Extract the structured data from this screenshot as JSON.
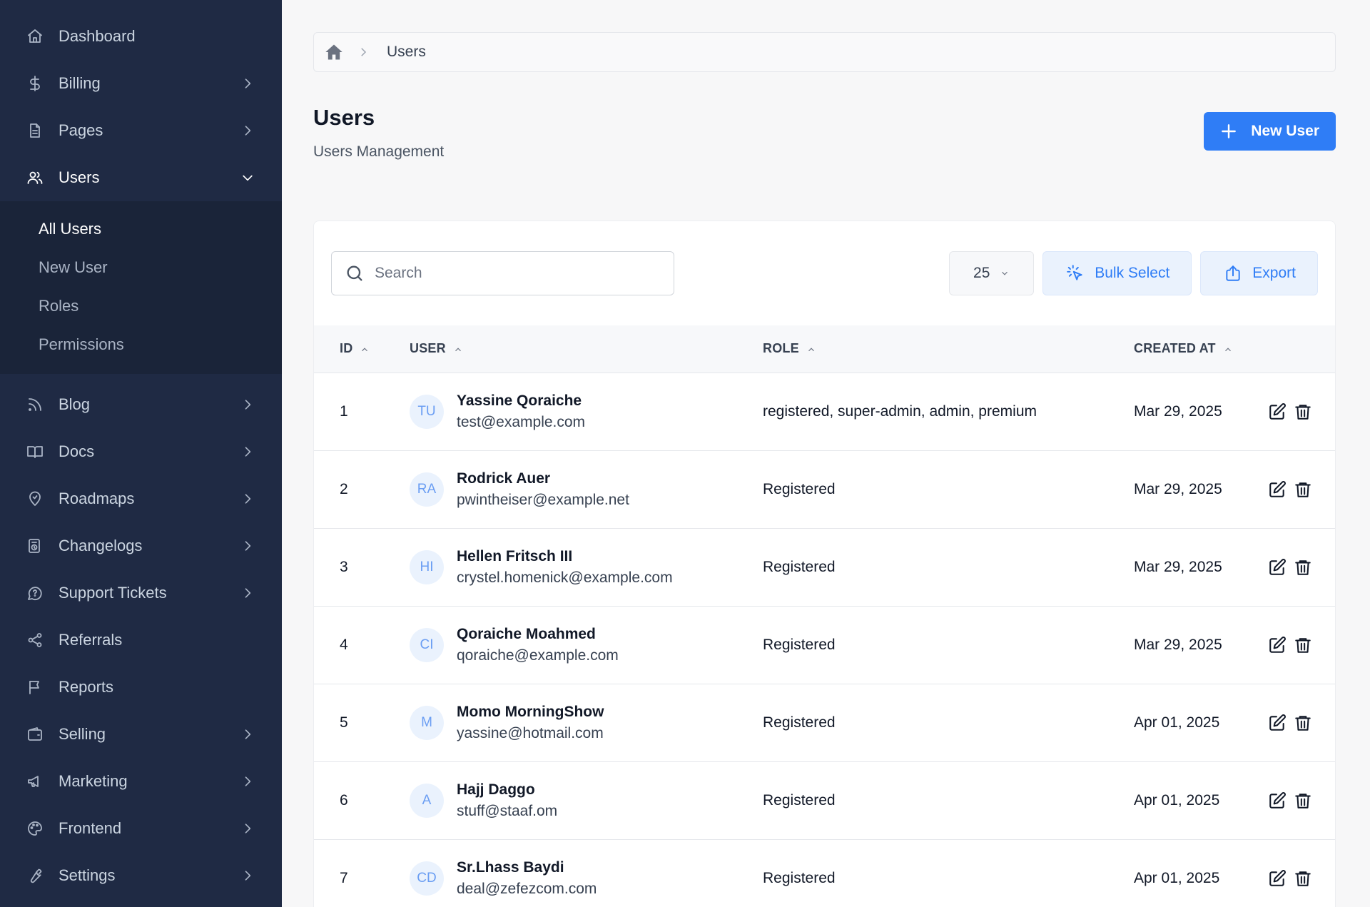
{
  "sidebar": {
    "items": [
      {
        "label": "Dashboard",
        "icon": "home-icon",
        "has_children": false
      },
      {
        "label": "Billing",
        "icon": "dollar-icon",
        "has_children": true
      },
      {
        "label": "Pages",
        "icon": "document-icon",
        "has_children": true
      },
      {
        "label": "Users",
        "icon": "users-icon",
        "has_children": true,
        "expanded": true
      },
      {
        "label": "Blog",
        "icon": "rss-icon",
        "has_children": true
      },
      {
        "label": "Docs",
        "icon": "book-icon",
        "has_children": true
      },
      {
        "label": "Roadmaps",
        "icon": "map-pin-icon",
        "has_children": true
      },
      {
        "label": "Changelogs",
        "icon": "changelog-icon",
        "has_children": true
      },
      {
        "label": "Support Tickets",
        "icon": "chat-icon",
        "has_children": true
      },
      {
        "label": "Referrals",
        "icon": "share-icon",
        "has_children": false
      },
      {
        "label": "Reports",
        "icon": "flag-icon",
        "has_children": false
      },
      {
        "label": "Selling",
        "icon": "wallet-icon",
        "has_children": true
      },
      {
        "label": "Marketing",
        "icon": "megaphone-icon",
        "has_children": true
      },
      {
        "label": "Frontend",
        "icon": "palette-icon",
        "has_children": true
      },
      {
        "label": "Settings",
        "icon": "wrench-icon",
        "has_children": true
      }
    ],
    "users_submenu": [
      "All Users",
      "New User",
      "Roles",
      "Permissions"
    ]
  },
  "breadcrumb": {
    "current": "Users"
  },
  "header": {
    "title": "Users",
    "subtitle": "Users Management",
    "new_button": "New User"
  },
  "toolbar": {
    "search_placeholder": "Search",
    "per_page": "25",
    "bulk_select": "Bulk Select",
    "export": "Export"
  },
  "table": {
    "columns": [
      "ID",
      "USER",
      "ROLE",
      "CREATED AT"
    ],
    "rows": [
      {
        "id": "1",
        "initials": "TU",
        "name": "Yassine Qoraiche",
        "email": "test@example.com",
        "role": "registered, super-admin, admin, premium",
        "created": "Mar 29, 2025"
      },
      {
        "id": "2",
        "initials": "RA",
        "name": "Rodrick Auer",
        "email": "pwintheiser@example.net",
        "role": "Registered",
        "created": "Mar 29, 2025"
      },
      {
        "id": "3",
        "initials": "HI",
        "name": "Hellen Fritsch III",
        "email": "crystel.homenick@example.com",
        "role": "Registered",
        "created": "Mar 29, 2025"
      },
      {
        "id": "4",
        "initials": "CI",
        "name": "Qoraiche Moahmed",
        "email": "qoraiche@example.com",
        "role": "Registered",
        "created": "Mar 29, 2025"
      },
      {
        "id": "5",
        "initials": "M",
        "name": "Momo MorningShow",
        "email": "yassine@hotmail.com",
        "role": "Registered",
        "created": "Apr 01, 2025"
      },
      {
        "id": "6",
        "initials": "A",
        "name": "Hajj Daggo",
        "email": "stuff@staaf.om",
        "role": "Registered",
        "created": "Apr 01, 2025"
      },
      {
        "id": "7",
        "initials": "CD",
        "name": "Sr.Lhass Baydi",
        "email": "deal@zefezcom.com",
        "role": "Registered",
        "created": "Apr 01, 2025"
      }
    ]
  },
  "colors": {
    "sidebar_bg": "#1f2a44",
    "accent": "#2f7df6",
    "page_bg": "#f7f7f8"
  }
}
